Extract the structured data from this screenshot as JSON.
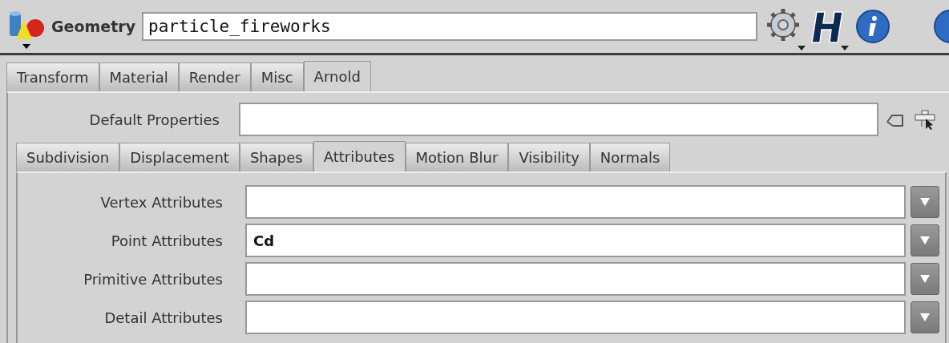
{
  "header": {
    "label": "Geometry",
    "name": "particle_fireworks"
  },
  "tabs": [
    {
      "label": "Transform",
      "selected": false
    },
    {
      "label": "Material",
      "selected": false
    },
    {
      "label": "Render",
      "selected": false
    },
    {
      "label": "Misc",
      "selected": false
    },
    {
      "label": "Arnold",
      "selected": true
    }
  ],
  "default_properties": {
    "label": "Default Properties"
  },
  "subtabs": [
    {
      "label": "Subdivision",
      "selected": false
    },
    {
      "label": "Displacement",
      "selected": false
    },
    {
      "label": "Shapes",
      "selected": false
    },
    {
      "label": "Attributes",
      "selected": true
    },
    {
      "label": "Motion Blur",
      "selected": false
    },
    {
      "label": "Visibility",
      "selected": false
    },
    {
      "label": "Normals",
      "selected": false
    }
  ],
  "fields": [
    {
      "label": "Vertex Attributes"
    },
    {
      "label": "Point Attributes",
      "value": "Cd"
    },
    {
      "label": "Primitive Attributes"
    },
    {
      "label": "Detail Attributes"
    }
  ]
}
